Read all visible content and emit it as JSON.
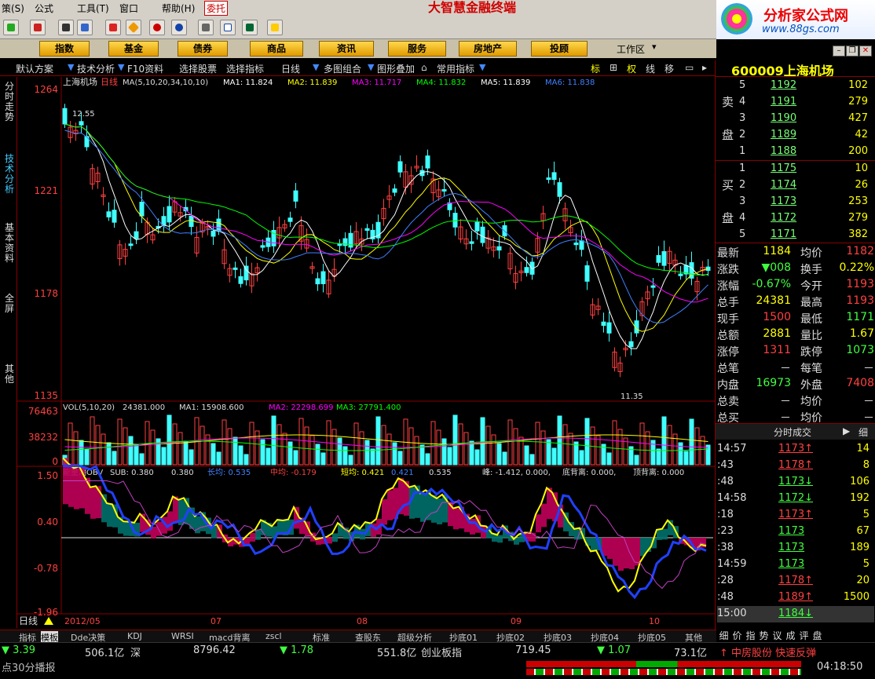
{
  "menubar": {
    "items": [
      "策(S)",
      "公式",
      "工具(T)",
      "窗口",
      "帮助(H)",
      "委托"
    ],
    "app_title": "大智慧金融终端"
  },
  "logo": {
    "line1": "分析家公式网",
    "line2": "www.88gs.com"
  },
  "navbar": {
    "buttons": [
      "指数",
      "基金",
      "债券",
      "商品",
      "资讯",
      "服务",
      "房地产",
      "投顾"
    ],
    "workarea": "工作区"
  },
  "funcbar": {
    "items": [
      "默认方案",
      "技术分析",
      "F10资料",
      "选择股票",
      "选择指标",
      "日线",
      "多图组合",
      "图形叠加",
      "常用指标",
      "标",
      "权",
      "线",
      "移"
    ]
  },
  "lefttabs": [
    "分时走势",
    "技术分析",
    "基本资料",
    "全屏",
    "其他"
  ],
  "price_panel": {
    "stock": "上海机场",
    "period": "日线",
    "indicator": "MA(5,10,20,34,10,10)",
    "labels": [
      {
        "k": "MA1: 11.824",
        "c": "#ffffff"
      },
      {
        "k": "MA2: 11.839",
        "c": "#ffff00"
      },
      {
        "k": "MA3: 11.717",
        "c": "#ff00ff"
      },
      {
        "k": "MA4: 11.832",
        "c": "#00ff00"
      },
      {
        "k": "MA5: 11.839",
        "c": "#ffffff"
      },
      {
        "k": "MA6: 11.838",
        "c": "#4080ff"
      }
    ],
    "yticks": [
      "1264",
      "1221",
      "1178",
      "1135"
    ],
    "hi_label": "12.55",
    "lo_label": "11.35"
  },
  "vol_panel": {
    "title": "VOL(5,10,20)",
    "values": [
      "24381.000",
      "MA1: 15908.600",
      "MA2: 22298.699",
      "MA3: 27791.400"
    ],
    "yticks": [
      "76463",
      "38232",
      "0"
    ]
  },
  "obv_panel": {
    "title": "能量潮OBV",
    "labels": [
      "SUB: 0.380",
      "0.380",
      "长均: 0.535",
      "中均: -0.179",
      "短均: 0.421",
      "0.421",
      "0.535",
      "峰: -1.412, 0.000,",
      "底背离: 0.000,",
      "顶背离: 0.000"
    ],
    "yticks": [
      "1.50",
      "0.40",
      "-0.78",
      "-1.96"
    ]
  },
  "xaxis": {
    "labels": [
      "2012/05",
      "07",
      "08",
      "09",
      "10"
    ],
    "period": "日线"
  },
  "bottomtabs": [
    "指标",
    "模板",
    "Dde决策",
    "KDJ",
    "WRSI",
    "macd背离",
    "zscl",
    "标准",
    "查股东",
    "超级分析",
    "抄底01",
    "抄底02",
    "抄底03",
    "抄底04",
    "抄底05",
    "其他"
  ],
  "statusbar": {
    "items": [
      {
        "t": "▼ 3.39",
        "c": "#40ff40"
      },
      {
        "t": "506.1亿",
        "c": "#ddd"
      },
      {
        "t": "深",
        "c": "#ddd"
      },
      {
        "t": "8796.42",
        "c": "#ddd"
      },
      {
        "t": "▼ 1.78",
        "c": "#40ff40"
      },
      {
        "t": "551.8亿",
        "c": "#ddd"
      },
      {
        "t": "创业板指",
        "c": "#ddd"
      },
      {
        "t": "719.45",
        "c": "#ddd"
      },
      {
        "t": "▼ 1.07",
        "c": "#40ff40"
      },
      {
        "t": "73.1亿",
        "c": "#ddd"
      },
      {
        "t": "↑ 中房股份 快速反弹",
        "c": "#ff4040"
      }
    ],
    "bottom_left": "点30分播报",
    "clock": "04:18:50"
  },
  "rightpanel": {
    "code": "600009",
    "name": "上海机场",
    "sell_label": [
      "卖",
      "盘"
    ],
    "buy_label": [
      "买",
      "盘"
    ],
    "sell": [
      {
        "lv": "5",
        "p": "1192",
        "v": "102"
      },
      {
        "lv": "4",
        "p": "1191",
        "v": "279"
      },
      {
        "lv": "3",
        "p": "1190",
        "v": "427"
      },
      {
        "lv": "2",
        "p": "1189",
        "v": "42"
      },
      {
        "lv": "1",
        "p": "1188",
        "v": "200"
      }
    ],
    "buy": [
      {
        "lv": "1",
        "p": "1175",
        "v": "10"
      },
      {
        "lv": "2",
        "p": "1174",
        "v": "26"
      },
      {
        "lv": "3",
        "p": "1173",
        "v": "253"
      },
      {
        "lv": "4",
        "p": "1172",
        "v": "279"
      },
      {
        "lv": "5",
        "p": "1171",
        "v": "382"
      }
    ],
    "stats": [
      {
        "k1": "最新",
        "v1": "1184",
        "c1": "#ff0",
        "k2": "均价",
        "v2": "1182",
        "c2": "#ff4040"
      },
      {
        "k1": "涨跌",
        "v1": "▼008",
        "c1": "#40ff40",
        "k2": "换手",
        "v2": "0.22%",
        "c2": "#ff0"
      },
      {
        "k1": "涨幅",
        "v1": "-0.67%",
        "c1": "#40ff40",
        "k2": "今开",
        "v2": "1193",
        "c2": "#ff4040"
      },
      {
        "k1": "总手",
        "v1": "24381",
        "c1": "#ff0",
        "k2": "最高",
        "v2": "1193",
        "c2": "#ff4040"
      },
      {
        "k1": "现手",
        "v1": "1500",
        "c1": "#ff4040",
        "k2": "最低",
        "v2": "1171",
        "c2": "#40ff40"
      },
      {
        "k1": "总额",
        "v1": "2881",
        "c1": "#ff0",
        "k2": "量比",
        "v2": "1.67",
        "c2": "#ff0"
      },
      {
        "k1": "涨停",
        "v1": "1311",
        "c1": "#ff4040",
        "k2": "跌停",
        "v2": "1073",
        "c2": "#40ff40"
      },
      {
        "k1": "总笔",
        "v1": "－",
        "c1": "#ddd",
        "k2": "每笔",
        "v2": "－",
        "c2": "#ddd"
      },
      {
        "k1": "内盘",
        "v1": "16973",
        "c1": "#40ff40",
        "k2": "外盘",
        "v2": "7408",
        "c2": "#ff4040"
      },
      {
        "k1": "总卖",
        "v1": "－",
        "c1": "#ddd",
        "k2": "均价",
        "v2": "－",
        "c2": "#ddd"
      },
      {
        "k1": "总买",
        "v1": "－",
        "c1": "#ddd",
        "k2": "均价",
        "v2": "－",
        "c2": "#ddd"
      }
    ],
    "trades_title": "分时成交",
    "trades_more": "细",
    "trades": [
      {
        "t": "14:57",
        "p": "1173",
        "a": "↑",
        "v": "14"
      },
      {
        "t": ":43",
        "p": "1178",
        "a": "↑",
        "v": "8"
      },
      {
        "t": ":48",
        "p": "1173",
        "a": "↓",
        "v": "106"
      },
      {
        "t": "14:58",
        "p": "1172",
        "a": "↓",
        "v": "192"
      },
      {
        "t": ":18",
        "p": "1173",
        "a": "↑",
        "v": "5"
      },
      {
        "t": ":23",
        "p": "1173",
        "a": "",
        "v": "67"
      },
      {
        "t": ":38",
        "p": "1173",
        "a": "",
        "v": "189"
      },
      {
        "t": "14:59",
        "p": "1173",
        "a": "",
        "v": "5"
      },
      {
        "t": ":28",
        "p": "1178",
        "a": "↑",
        "v": "20"
      },
      {
        "t": ":48",
        "p": "1189",
        "a": "↑",
        "v": "1500"
      },
      {
        "t": "15:00",
        "p": "1184",
        "a": "↓",
        "v": ""
      }
    ],
    "tabs": [
      "细",
      "价",
      "指",
      "势",
      "议",
      "成",
      "评",
      "盘"
    ]
  }
}
